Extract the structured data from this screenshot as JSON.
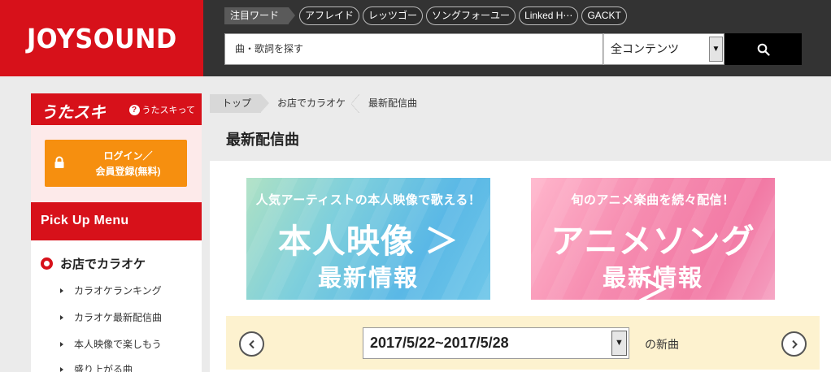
{
  "header": {
    "logo": "JOYSOUND",
    "trending_label": "注目ワード",
    "trending_words": [
      "アフレイド",
      "レッツゴー",
      "ソングフォーユー",
      "Linked H⋯",
      "GACKT"
    ],
    "search_placeholder": "曲・歌詞を探す",
    "search_scope": "全コンテンツ",
    "search_icon": "magnifier-icon"
  },
  "sidebar": {
    "utasuki_title": "うたスキ",
    "utasuki_help": "うたスキって",
    "login_line1": "ログイン／",
    "login_line2": "会員登録(無料)",
    "pickup_title": "Pick Up Menu",
    "section_title": "お店でカラオケ",
    "items": [
      "カラオケランキング",
      "カラオケ最新配信曲",
      "本人映像で楽しもう",
      "盛り上がる曲"
    ],
    "accent_color": "#d7111a",
    "login_color": "#f68f0f"
  },
  "breadcrumb": [
    "トップ",
    "お店でカラオケ",
    "最新配信曲"
  ],
  "main": {
    "title": "最新配信曲",
    "banners": [
      {
        "top": "人気アーティストの本人映像で歌える！",
        "main": "本人映像 ＞",
        "sub": "最新情報",
        "color": "#5ab8e6"
      },
      {
        "top": "旬のアニメ楽曲を続々配信！",
        "main": "アニメソング ＞",
        "sub": "最新情報",
        "color": "#f27aa5"
      }
    ],
    "week_range": "2017/5/22~2017/5/28",
    "week_suffix": "の新曲"
  }
}
